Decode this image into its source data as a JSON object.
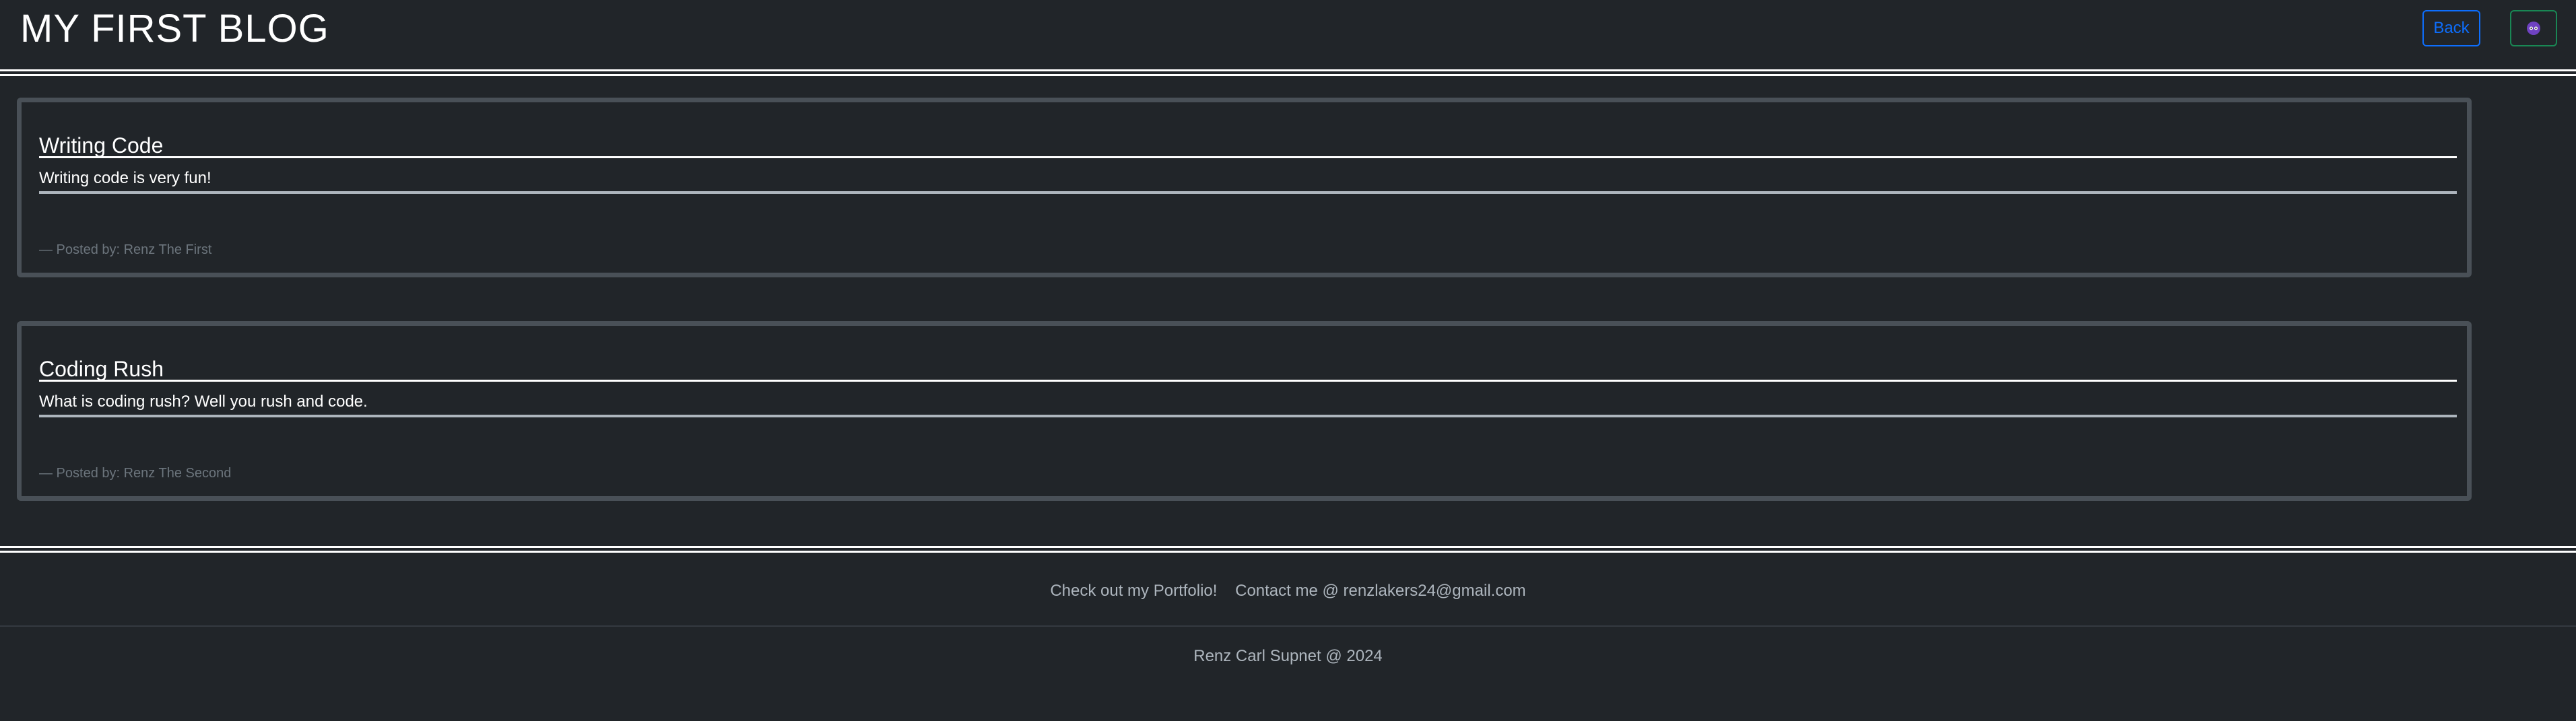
{
  "header": {
    "title": "MY FIRST BLOG",
    "back_label": "Back",
    "theme_icon": "theme-toggle-icon"
  },
  "posts": [
    {
      "title": "Writing Code",
      "body": "Writing code is very fun!",
      "meta": "— Posted by: Renz The First"
    },
    {
      "title": "Coding Rush",
      "body": "What is coding rush? Well you rush and code.",
      "meta": "— Posted by: Renz The Second"
    }
  ],
  "footer": {
    "portfolio_label": "Check out my Portfolio!",
    "contact_label": "Contact me @ renzlakers24@gmail.com",
    "copyright": "Renz Carl Supnet @ 2024"
  },
  "colors": {
    "background": "#212529",
    "primary": "#0d6efd",
    "success": "#198754",
    "card_border": "#495057",
    "muted": "#6c757d"
  }
}
